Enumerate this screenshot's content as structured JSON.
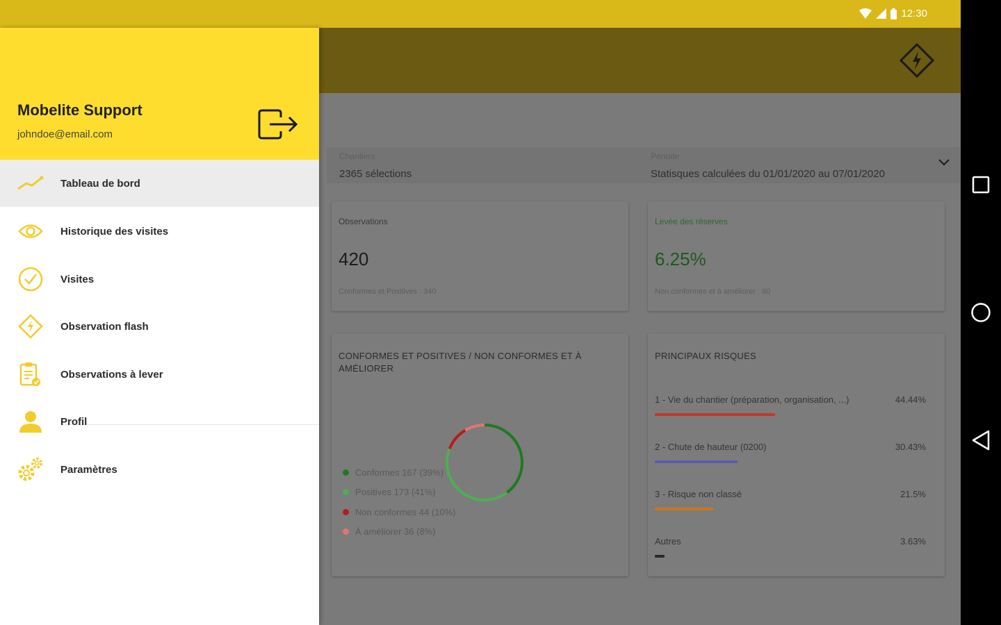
{
  "status_bar": {
    "time": "12:30"
  },
  "drawer": {
    "user_name": "Mobelite Support",
    "user_email": "johndoe@email.com",
    "menu": [
      {
        "label": "Tableau de bord",
        "icon": "chart-line-icon",
        "active": true
      },
      {
        "label": "Historique des visites",
        "icon": "eye-icon"
      },
      {
        "label": "Visites",
        "icon": "check-circle-icon"
      },
      {
        "label": "Observation flash",
        "icon": "flash-diamond-icon"
      },
      {
        "label": "Observations à lever",
        "icon": "clipboard-check-icon"
      },
      {
        "label": "Profil",
        "icon": "user-icon"
      },
      {
        "label": "Paramètres",
        "icon": "gears-icon"
      }
    ]
  },
  "dashboard": {
    "filters": {
      "chantiers_label": "Chantiers",
      "chantiers_value": "2365 sélections",
      "periode_label": "Période",
      "periode_value": "Statisques calculées du 01/01/2020  au  07/01/2020"
    },
    "observations_card": {
      "title": "Observations",
      "value": "420",
      "sub": "Conformes et Positives : 340"
    },
    "reserves_card": {
      "title": "Levée des réserves",
      "value": "6.25%",
      "sub": "Non conformes et à améliorer : 60"
    },
    "conformity_chart": {
      "title": "CONFORMES ET POSITIVES / NON CONFORMES ET À AMÉLIORER",
      "legend": [
        {
          "label": "Conformes 167 (39%)",
          "color": "#1f7a1f"
        },
        {
          "label": "Positives 173 (41%)",
          "color": "#4caf50"
        },
        {
          "label": "Non conformes 44 (10%)",
          "color": "#b71c1c"
        },
        {
          "label": "À améliorer 36 (8%)",
          "color": "#e57373"
        }
      ]
    },
    "risks": {
      "title": "PRINCIPAUX RISQUES",
      "items": [
        {
          "label": "1 - Vie du chantier (préparation, organisation, ...)",
          "pct": "44.44%",
          "fraction": 0.4444,
          "color": "#c0392b"
        },
        {
          "label": "2 - Chute de hauteur (0200)",
          "pct": "30.43%",
          "fraction": 0.3043,
          "color": "#5b5bb0"
        },
        {
          "label": "3 - Risque non classé",
          "pct": "21.5%",
          "fraction": 0.215,
          "color": "#c8781e"
        },
        {
          "label": "Autres",
          "pct": "3.63%",
          "fraction": 0.0363,
          "color": "#2a2a2a"
        }
      ]
    }
  },
  "chart_data": {
    "type": "pie",
    "title": "CONFORMES ET POSITIVES / NON CONFORMES ET À AMÉLIORER",
    "categories": [
      "Conformes",
      "Positives",
      "Non conformes",
      "À améliorer"
    ],
    "values": [
      167,
      173,
      44,
      36
    ],
    "percentages": [
      39,
      41,
      10,
      8
    ],
    "colors": [
      "#1f7a1f",
      "#4caf50",
      "#b71c1c",
      "#e57373"
    ],
    "legend": "left"
  }
}
